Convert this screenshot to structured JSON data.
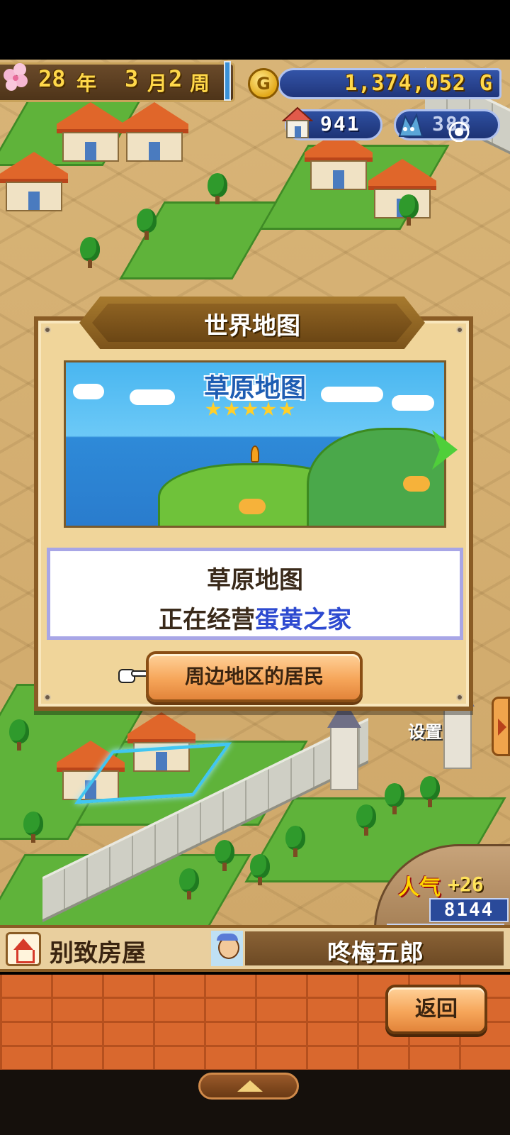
{
  "hud": {
    "date": {
      "year": "28",
      "year_unit": "年",
      "month": "3",
      "month_unit": "月",
      "week": "2",
      "week_unit": "周"
    },
    "gold_icon_letter": "G",
    "money": "1,374,052 G",
    "population": "941",
    "visitors": "388"
  },
  "dialog": {
    "title": "世界地图",
    "preview": {
      "title": "草原地图",
      "stars": 5
    },
    "info": {
      "map_name": "草原地图",
      "status_prefix": "正在经营",
      "shop_name": "蛋黄之家"
    },
    "residents_button": "周边地区的居民"
  },
  "build_label": "设置",
  "popularity": {
    "label": "人气",
    "change": "+26",
    "value": "8144",
    "bar_fraction": 0.45
  },
  "info_bar": {
    "building_name": "别致房屋",
    "resident_name": "咚梅五郎"
  },
  "back_button": "返回",
  "colors": {
    "accent_blue": "#2d4ad0",
    "button_orange": "#f6a65a",
    "gold_text": "#ffd84a"
  }
}
